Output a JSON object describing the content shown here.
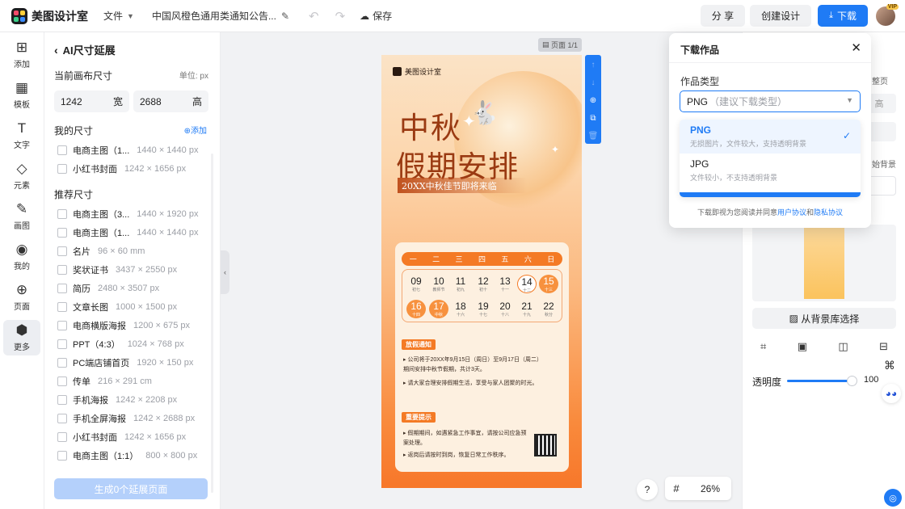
{
  "topbar": {
    "app_name": "美图设计室",
    "file_menu": "文件",
    "doc_title": "中国风橙色通用类通知公告...",
    "save_label": "保存",
    "share_label": "分 享",
    "create_label": "创建设计",
    "download_label": "下载",
    "avatar_badge": "VIP"
  },
  "rail": {
    "items": [
      {
        "icon": "add-icon",
        "label": "添加"
      },
      {
        "icon": "template-icon",
        "label": "模板"
      },
      {
        "icon": "text-icon",
        "label": "文字"
      },
      {
        "icon": "shapes-icon",
        "label": "元素"
      },
      {
        "icon": "draw-icon",
        "label": "画图"
      },
      {
        "icon": "user-icon",
        "label": "我的"
      },
      {
        "icon": "page-icon",
        "label": "页面"
      },
      {
        "icon": "more-icon",
        "label": "更多"
      }
    ]
  },
  "panel": {
    "title": "AI尺寸延展",
    "current_label": "当前画布尺寸",
    "unit": "单位: px",
    "width": "1242",
    "width_label": "宽",
    "height": "2688",
    "height_label": "高",
    "my_sizes_label": "我的尺寸",
    "add_label": "添加",
    "my_sizes": [
      {
        "name": "电商主图（1...",
        "size": "1440 × 1440 px"
      },
      {
        "name": "小红书封面",
        "size": "1242 × 1656 px"
      }
    ],
    "recommended_label": "推荐尺寸",
    "recommended": [
      {
        "name": "电商主图（3...",
        "size": "1440 × 1920 px"
      },
      {
        "name": "电商主图（1...",
        "size": "1440 × 1440 px"
      },
      {
        "name": "名片",
        "size": "96 × 60 mm"
      },
      {
        "name": "奖状证书",
        "size": "3437 × 2550 px"
      },
      {
        "name": "简历",
        "size": "2480 × 3507 px"
      },
      {
        "name": "文章长图",
        "size": "1000 × 1500 px"
      },
      {
        "name": "电商横版海报",
        "size": "1200 × 675 px"
      },
      {
        "name": "PPT（4:3）",
        "size": "1024 × 768 px"
      },
      {
        "name": "PC端店铺首页",
        "size": "1920 × 150 px"
      },
      {
        "name": "传单",
        "size": "216 × 291 cm"
      },
      {
        "name": "手机海报",
        "size": "1242 × 2208 px"
      },
      {
        "name": "手机全屏海报",
        "size": "1242 × 2688 px"
      },
      {
        "name": "小红书封面",
        "size": "1242 × 1656 px"
      },
      {
        "name": "电商主图（1:1）",
        "size": "800 × 800 px"
      }
    ],
    "generate_label": "生成0个延展页面"
  },
  "canvas": {
    "page_tag": "页面 1/1",
    "zoom": "26%",
    "help": "?"
  },
  "poster": {
    "brand": "美图设计室",
    "title_line1": "中秋",
    "title_line2": "假期安排",
    "subtitle": "20XX中秋佳节即将来临",
    "weekdays": [
      "一",
      "二",
      "三",
      "四",
      "五",
      "六",
      "日"
    ],
    "days": [
      {
        "n": "09",
        "s": "初七"
      },
      {
        "n": "10",
        "s": "教师节"
      },
      {
        "n": "11",
        "s": "初九"
      },
      {
        "n": "12",
        "s": "初十"
      },
      {
        "n": "13",
        "s": "十一"
      },
      {
        "n": "14",
        "s": "十二"
      },
      {
        "n": "15",
        "s": "十三"
      },
      {
        "n": "16",
        "s": "十四"
      },
      {
        "n": "17",
        "s": "中秋"
      },
      {
        "n": "18",
        "s": "十六"
      },
      {
        "n": "19",
        "s": "十七"
      },
      {
        "n": "20",
        "s": "十八"
      },
      {
        "n": "21",
        "s": "十九"
      },
      {
        "n": "22",
        "s": "秋分"
      }
    ],
    "notice_title": "放假通知",
    "notice_1": "公司将于20XX年9月15日（周日）至9月17日（周二）期间安排中秋节假期，共计3天。",
    "notice_2": "请大家合理安排假期生活，享受与家人团聚的时光。",
    "tips_title": "重要提示",
    "tip_1": "假期期间，如遇紧急工作事宜，请按公司应急预案处理。",
    "tip_2": "返岗后请按时到岗，恢复日常工作秩序。"
  },
  "rpanel": {
    "frag_top": "整页",
    "box_value": "高",
    "frag_bg": "始背景",
    "library_label": "从背景库选择",
    "opacity_label": "透明度",
    "opacity_value": "100"
  },
  "dialog": {
    "title": "下载作品",
    "type_label": "作品类型",
    "selected_value": "PNG",
    "selected_hint": "（建议下载类型）",
    "options": [
      {
        "name": "PNG",
        "desc": "无损图片，文件较大，支持透明背景",
        "selected": true
      },
      {
        "name": "JPG",
        "desc": "文件较小，不支持透明背景",
        "selected": false
      }
    ],
    "footer_prefix": "下载即视为您阅读并同意",
    "user_agreement": "用户协议",
    "and": "和",
    "privacy": "隐私协议"
  },
  "colors": {
    "accent": "#1f7bf5",
    "poster_orange": "#f47a25"
  }
}
